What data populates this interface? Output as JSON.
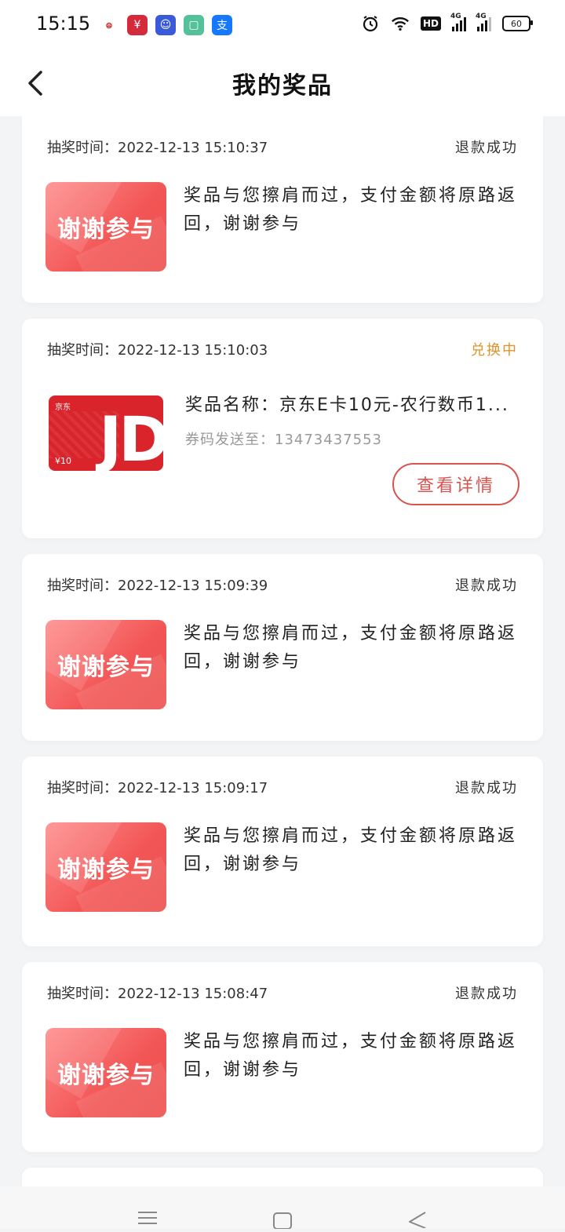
{
  "status_bar": {
    "time": "15:15",
    "apps": [
      {
        "icon": "icbc-icon",
        "color": "#ffffff"
      },
      {
        "icon": "digital-rmb-icon",
        "color": "#d42b3c"
      },
      {
        "icon": "qq-icon",
        "color": "#3a5bd9"
      },
      {
        "icon": "green-app-icon",
        "color": "#55c19a"
      },
      {
        "icon": "alipay-icon",
        "color": "#1677ff"
      }
    ],
    "hd_label": "HD",
    "network_1": "4G",
    "network_2": "4G",
    "battery": "60"
  },
  "header": {
    "title": "我的奖品"
  },
  "records": [
    {
      "kind": "thanks",
      "time_label": "抽奖时间：2022-12-13 15:10:37",
      "status": "退款成功",
      "image_text": "谢谢参与",
      "message": "奖品与您擦肩而过，支付金额将原路返回，谢谢参与"
    },
    {
      "kind": "prize",
      "time_label": "抽奖时间：2022-12-13 15:10:03",
      "status": "兑换中",
      "status_color": "#e0932b",
      "image_brand": "京东",
      "image_letters": "JD",
      "image_price": "¥10",
      "prize_name": "奖品名称：京东E卡10元-农行数币1...",
      "coupon_to": "券码发送至：13473437553",
      "detail_button": "查看详情"
    },
    {
      "kind": "thanks",
      "time_label": "抽奖时间：2022-12-13 15:09:39",
      "status": "退款成功",
      "image_text": "谢谢参与",
      "message": "奖品与您擦肩而过，支付金额将原路返回，谢谢参与"
    },
    {
      "kind": "thanks",
      "time_label": "抽奖时间：2022-12-13 15:09:17",
      "status": "退款成功",
      "image_text": "谢谢参与",
      "message": "奖品与您擦肩而过，支付金额将原路返回，谢谢参与"
    },
    {
      "kind": "thanks",
      "time_label": "抽奖时间：2022-12-13 15:08:47",
      "status": "退款成功",
      "image_text": "谢谢参与",
      "message": "奖品与您擦肩而过，支付金额将原路返回，谢谢参与"
    }
  ],
  "nav_bar": {
    "icons": [
      "menu-icon",
      "home-square-icon",
      "back-triangle-icon"
    ]
  },
  "colors": {
    "accent_red": "#d9534f",
    "exchange_orange": "#e0932b",
    "background": "#f3f4f6"
  }
}
